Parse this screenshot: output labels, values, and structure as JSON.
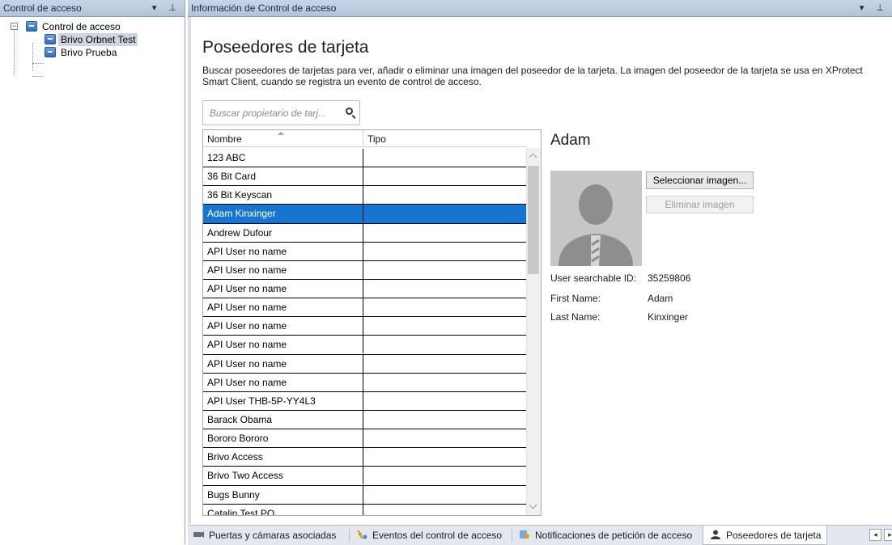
{
  "left_pane": {
    "header_title": "Control de acceso",
    "header_buttons": "▾ ⊥",
    "tree": {
      "root": {
        "expander": "−",
        "label": "Control de acceso"
      },
      "children": [
        "Brivo Orbnet Test",
        "Brivo Prueba"
      ]
    }
  },
  "right_pane": {
    "header_title": "Información de Control de acceso",
    "header_buttons": "▾ ⊥"
  },
  "main": {
    "title": "Poseedores de tarjeta",
    "description": "Buscar poseedores de tarjetas para ver, añadir o eliminar una imagen del poseedor de la tarjeta. La imagen del poseedor de la tarjeta se usa en XProtect Smart Client, cuando se registra un evento de control de acceso.",
    "search": {
      "placeholder": "Buscar propietario de tarj...",
      "value": ""
    },
    "grid": {
      "columns": [
        "Nombre",
        "Tipo"
      ],
      "rows": [
        [
          "123 ABC",
          ""
        ],
        [
          "36 Bit Card",
          ""
        ],
        [
          "36 Bit Keyscan",
          ""
        ],
        [
          "Adam Kinxinger",
          ""
        ],
        [
          "Andrew Dufour",
          ""
        ],
        [
          "API User no name",
          ""
        ],
        [
          "API User no name",
          ""
        ],
        [
          "API User no name",
          ""
        ],
        [
          "API User no name",
          ""
        ],
        [
          "API User no name",
          ""
        ],
        [
          "API User no name",
          ""
        ],
        [
          "API User no name",
          ""
        ],
        [
          "API User no name",
          ""
        ],
        [
          "API User THB-5P-YY4L3",
          ""
        ],
        [
          "Barack Obama",
          ""
        ],
        [
          "Bororo Bororo",
          ""
        ],
        [
          "Brivo Access",
          ""
        ],
        [
          "Brivo Two Access",
          ""
        ],
        [
          "Bugs Bunny",
          ""
        ],
        [
          "Catalin Test PO",
          ""
        ]
      ],
      "selected_index": 3
    },
    "detail": {
      "name": "Adam",
      "select_image_label": "Seleccionar imagen...",
      "remove_image_label": "Eliminar imagen",
      "properties": [
        {
          "label": "User searchable ID:",
          "value": "35259806"
        },
        {
          "label": "First Name:",
          "value": "Adam"
        },
        {
          "label": "Last Name:",
          "value": "Kinxinger"
        }
      ]
    }
  },
  "tabs": [
    {
      "label": "Puertas y cámaras asociadas",
      "icon": "door-camera-icon"
    },
    {
      "label": "Eventos del control de acceso",
      "icon": "events-icon"
    },
    {
      "label": "Notificaciones de petición de acceso",
      "icon": "notification-icon"
    },
    {
      "label": "Poseedores de tarjeta",
      "icon": "person-icon"
    }
  ],
  "active_tab_index": 3,
  "colors": {
    "selection": "#1675d1",
    "header_gradient_top": "#c9d4e6",
    "tab_bar": "#e3e8f0"
  }
}
